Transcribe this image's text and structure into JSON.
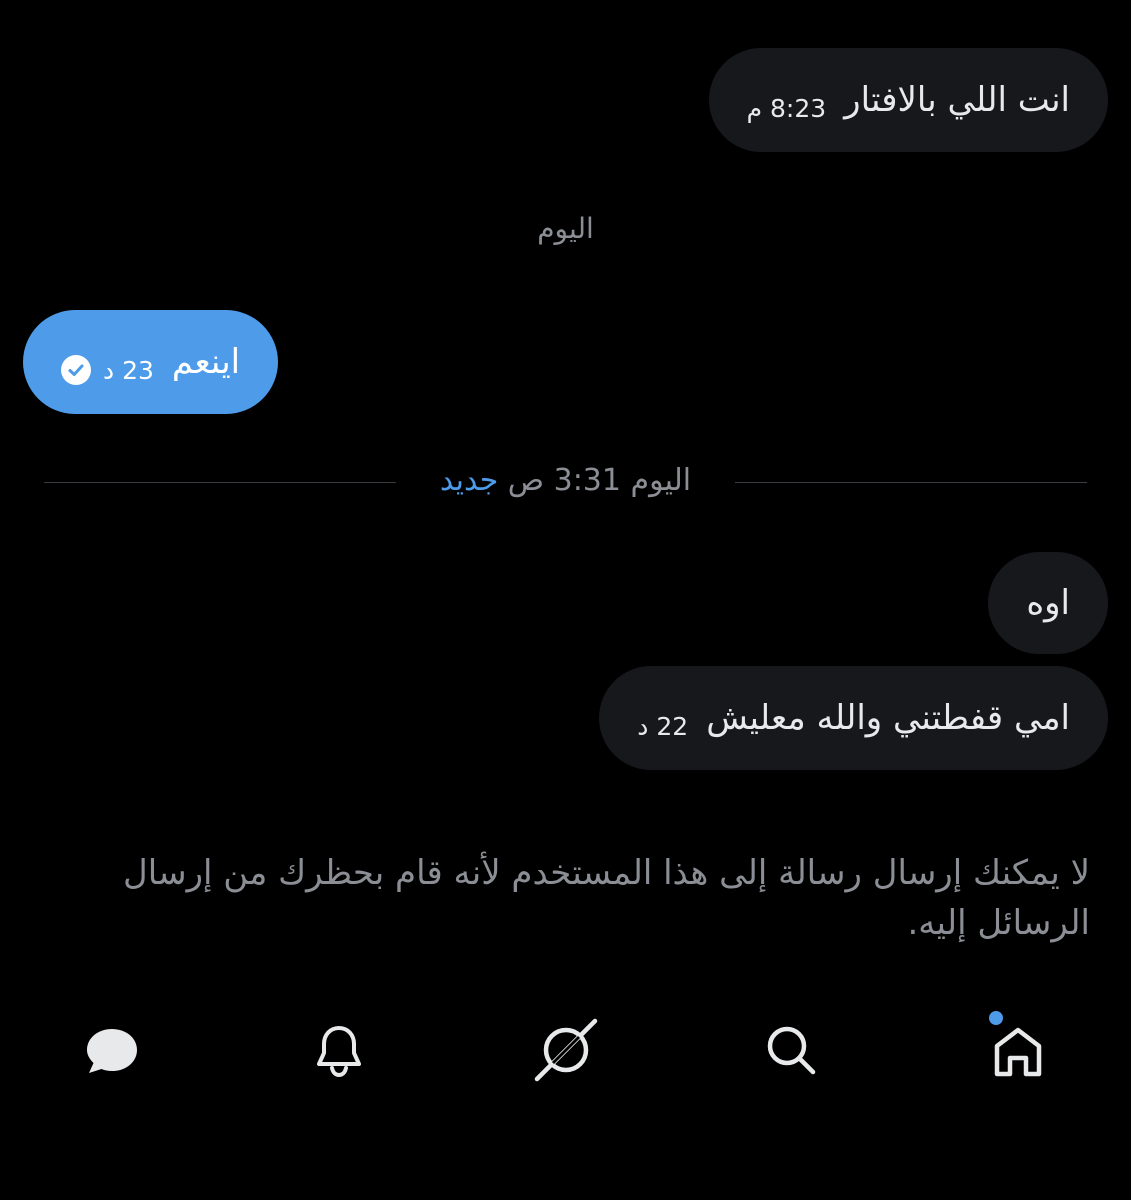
{
  "messages": [
    {
      "text": "انت اللي بالافتار",
      "time": "8:23 م"
    },
    {
      "text": "اينعم",
      "time": "23 د"
    },
    {
      "text": "اوه",
      "time": ""
    },
    {
      "text": "امي قفطتني والله معليش",
      "time": "22 د"
    }
  ],
  "day_label": "اليوم",
  "new_divider": {
    "prefix": "اليوم 3:31 ص",
    "new_label": "جديد"
  },
  "blocked_notice": "لا يمكنك إرسال رسالة إلى هذا المستخدم لأنه قام بحظرك من إرسال الرسائل إليه.",
  "nav": {
    "items": [
      "messages-icon",
      "notifications-icon",
      "grok-icon",
      "search-icon",
      "home-icon"
    ],
    "home_has_notification": true
  },
  "colors": {
    "background": "#000000",
    "received_bubble": "#16181c",
    "sent_bubble": "#4d9be9",
    "accent": "#4d9be9",
    "muted_text": "#8b8f95"
  }
}
